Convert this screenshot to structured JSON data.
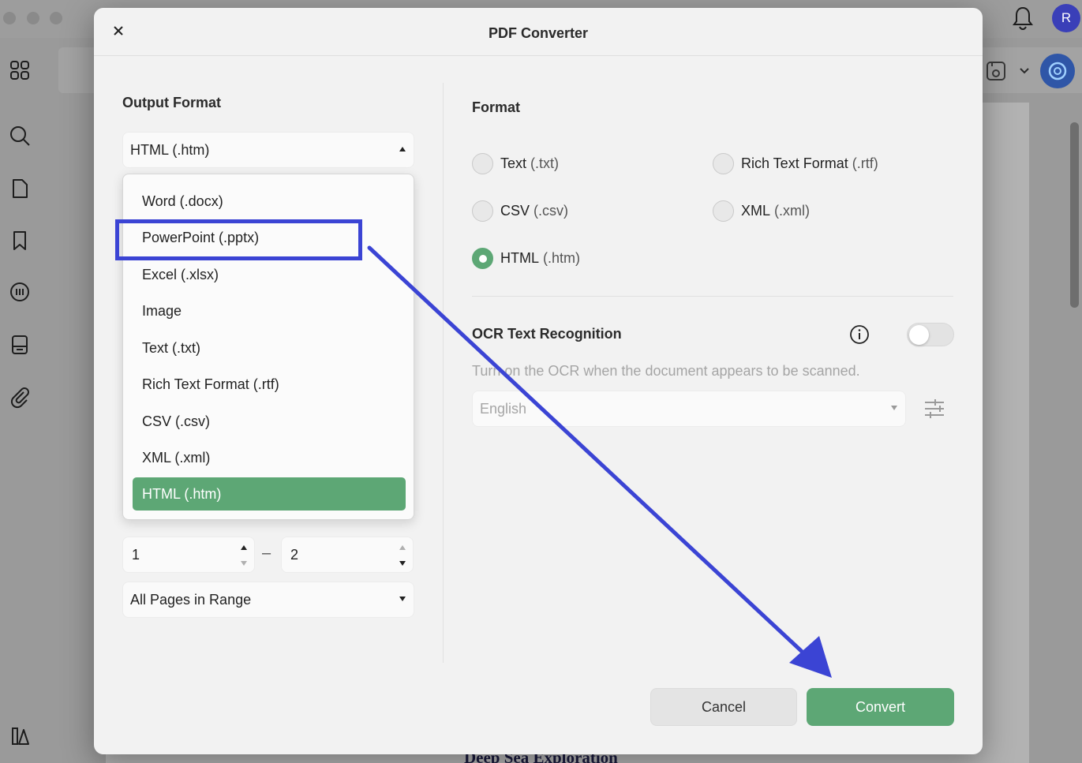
{
  "dialog": {
    "title": "PDF Converter",
    "close_icon": "close-icon"
  },
  "output_format": {
    "label": "Output Format",
    "selected": "HTML (.htm)",
    "options": [
      "Word (.docx)",
      "PowerPoint (.pptx)",
      "Excel (.xlsx)",
      "Image",
      "Text (.txt)",
      "Rich Text Format (.rtf)",
      "CSV (.csv)",
      "XML (.xml)",
      "HTML (.htm)"
    ]
  },
  "page_range": {
    "from": "1",
    "dash": "–",
    "to": "2",
    "subset": "All Pages in Range"
  },
  "format": {
    "label": "Format",
    "options": [
      {
        "name": "Text",
        "ext": "(.txt)",
        "checked": false
      },
      {
        "name": "Rich Text Format",
        "ext": "(.rtf)",
        "checked": false
      },
      {
        "name": "CSV",
        "ext": "(.csv)",
        "checked": false
      },
      {
        "name": "XML",
        "ext": "(.xml)",
        "checked": false
      },
      {
        "name": "HTML",
        "ext": "(.htm)",
        "checked": true
      }
    ]
  },
  "ocr": {
    "label": "OCR Text Recognition",
    "enabled": false,
    "description": "Turn on the OCR when the document appears to be scanned.",
    "language": "English"
  },
  "buttons": {
    "cancel": "Cancel",
    "convert": "Convert"
  },
  "background": {
    "avatar_initial": "R",
    "doc_heading": "Deep Sea Exploration"
  },
  "colors": {
    "accent_green": "#5da775",
    "annotation_blue": "#3b44d4",
    "avatar_blue": "#3a3fb8"
  }
}
